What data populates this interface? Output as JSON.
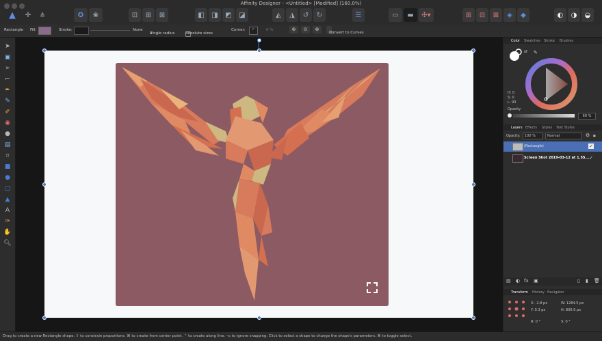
{
  "window": {
    "title": "Affinity Designer - <Untitled> [Modified] (160.0%)"
  },
  "context": {
    "tool_name": "Rectangle",
    "fill_label": "Fill:",
    "stroke_label": "Stroke:",
    "stroke_value": "None",
    "single_radius": "Single radius",
    "absolute_sizes": "Absolute sizes",
    "corner_label": "Corner:",
    "corner_value": "0 %",
    "convert_label": "Convert to Curves"
  },
  "color_panel": {
    "tabs": [
      "Color",
      "Swatches",
      "Stroke",
      "Brushes"
    ],
    "hsl": [
      "H: 0",
      "S: 0",
      "L: 93"
    ],
    "opacity_label": "Opacity",
    "opacity_value": "60 %"
  },
  "layers_panel": {
    "tabs": [
      "Layers",
      "Effects",
      "Styles",
      "Text Styles"
    ],
    "opacity_label": "Opacity:",
    "opacity_value": "100 %",
    "blend_mode": "Normal",
    "layers": [
      {
        "name": "(Rectangle)",
        "selected": true
      },
      {
        "name": "Screen Shot 2019-03-12 at 1.55...",
        "selected": false
      }
    ]
  },
  "transform_panel": {
    "tabs": [
      "Transform",
      "History",
      "Navigator"
    ],
    "x": "-2.8 px",
    "y": "0.3 px",
    "w": "1284.5 px",
    "h": "800.9 px",
    "r": "0 °",
    "s": "0 °"
  },
  "status": "Drag to create a new Rectangle shape. ⇧ to constrain proportions. ⌘ to create from center point. ⌃ to create along line. ⌥ to ignore snapping. Click to select a shape to change the shape's parameters. ⌘ to toggle select.",
  "colors": {
    "artwork_bg": "#8c5a63",
    "accent": "#4a7bd0",
    "fill_swatch": "#8b6b8a"
  }
}
